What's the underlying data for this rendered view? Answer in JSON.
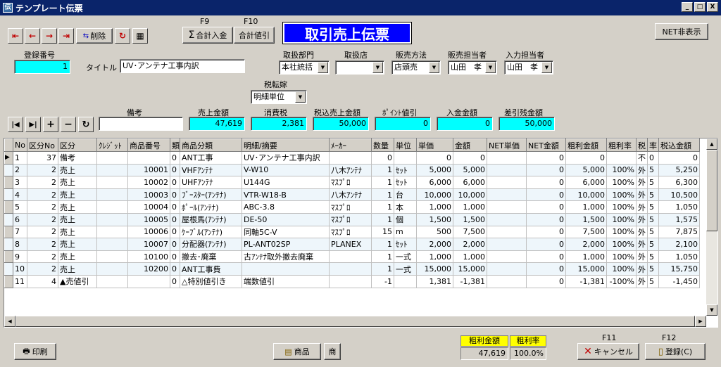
{
  "window": {
    "title": "テンプレート伝票",
    "min": "_",
    "max": "□",
    "close": "X"
  },
  "toolbar": {
    "first": "⇤",
    "prev": "←",
    "next": "→",
    "last": "⇥",
    "delete_label": "削除",
    "refresh": "↻",
    "calc": "▦",
    "f9": "F9",
    "f10": "F10",
    "sum_deposit": "合計入金",
    "sum_discount": "合計値引",
    "sigma": "Σ",
    "net_hide": "NET非表示"
  },
  "doc_title": "取引売上伝票",
  "header": {
    "reg_no_label": "登録番号",
    "reg_no": "1",
    "title_label": "タイトル",
    "title_value": "UV･アンテナ工事内訳",
    "dept_label": "取扱部門",
    "dept": "本社統括",
    "store_label": "取扱店",
    "store": "",
    "method_label": "販売方法",
    "method": "店頭売",
    "sales_person_label": "販売担当者",
    "sales_person": "山田　孝",
    "input_person_label": "入力担当者",
    "input_person": "山田　孝",
    "tax_label": "税転嫁",
    "tax": "明細単位",
    "memo_label": "備考",
    "memo": "",
    "sales_amount_label": "売上金額",
    "sales_amount": "47,619",
    "consumption_tax_label": "消費税",
    "consumption_tax": "2,381",
    "tax_incl_label": "税込売上金額",
    "tax_incl": "50,000",
    "point_label": "ﾎﾟｲﾝﾄ値引",
    "point": "0",
    "deposit_label": "入金金額",
    "deposit": "0",
    "balance_label": "差引残金額",
    "balance": "50,000"
  },
  "nav": {
    "first": "|◀",
    "last": "▶|",
    "add": "+",
    "remove": "−",
    "refresh": "↻"
  },
  "table": {
    "headers": [
      "No",
      "区分No",
      "区分",
      "ｸﾚｼﾞｯﾄ",
      "商品番号",
      "類",
      "商品分類",
      "明細/摘要",
      "ﾒｰｶｰ",
      "数量",
      "単位",
      "単価",
      "金額",
      "NET単価",
      "NET金額",
      "粗利金額",
      "粗利率",
      "税",
      "率",
      "税込金額"
    ],
    "rows": [
      [
        "1",
        "37",
        "備考",
        "",
        "",
        "0",
        "ANT工事",
        "UV･アンテナ工事内訳",
        "",
        "0",
        "",
        "0",
        "0",
        "",
        "0",
        "0",
        "",
        "不",
        "0",
        "0"
      ],
      [
        "2",
        "2",
        "売上",
        "",
        "10001",
        "0",
        "VHFｱﾝﾃﾅ",
        "V-W10",
        "八木ｱﾝﾃﾅ",
        "1",
        "ｾｯﾄ",
        "5,000",
        "5,000",
        "",
        "0",
        "5,000",
        "100%",
        "外",
        "5",
        "5,250"
      ],
      [
        "3",
        "2",
        "売上",
        "",
        "10002",
        "0",
        "UHFｱﾝﾃﾅ",
        "U144G",
        "ﾏｽﾌﾟﾛ",
        "1",
        "ｾｯﾄ",
        "6,000",
        "6,000",
        "",
        "0",
        "6,000",
        "100%",
        "外",
        "5",
        "6,300"
      ],
      [
        "4",
        "2",
        "売上",
        "",
        "10003",
        "0",
        "ﾌﾞｰｽﾀｰ(ｱﾝﾃﾅ)",
        "VTR-W18-B",
        "八木ｱﾝﾃﾅ",
        "1",
        "台",
        "10,000",
        "10,000",
        "",
        "0",
        "10,000",
        "100%",
        "外",
        "5",
        "10,500"
      ],
      [
        "5",
        "2",
        "売上",
        "",
        "10004",
        "0",
        "ﾎﾟｰﾙ(ｱﾝﾃﾅ)",
        "ABC-3.8",
        "ﾏｽﾌﾟﾛ",
        "1",
        "本",
        "1,000",
        "1,000",
        "",
        "0",
        "1,000",
        "100%",
        "外",
        "5",
        "1,050"
      ],
      [
        "6",
        "2",
        "売上",
        "",
        "10005",
        "0",
        "屋根馬(ｱﾝﾃﾅ)",
        "DE-50",
        "ﾏｽﾌﾟﾛ",
        "1",
        "個",
        "1,500",
        "1,500",
        "",
        "0",
        "1,500",
        "100%",
        "外",
        "5",
        "1,575"
      ],
      [
        "7",
        "2",
        "売上",
        "",
        "10006",
        "0",
        "ｹｰﾌﾞﾙ(ｱﾝﾃﾅ)",
        "同軸5C-V",
        "ﾏｽﾌﾟﾛ",
        "15",
        "m",
        "500",
        "7,500",
        "",
        "0",
        "7,500",
        "100%",
        "外",
        "5",
        "7,875"
      ],
      [
        "8",
        "2",
        "売上",
        "",
        "10007",
        "0",
        "分配器(ｱﾝﾃﾅ)",
        "PL-ANT02SP",
        "PLANEX",
        "1",
        "ｾｯﾄ",
        "2,000",
        "2,000",
        "",
        "0",
        "2,000",
        "100%",
        "外",
        "5",
        "2,100"
      ],
      [
        "9",
        "2",
        "売上",
        "",
        "10100",
        "0",
        "撤去･廃棄",
        "古ｱﾝﾃﾅ取外撤去廃棄",
        "",
        "1",
        "一式",
        "1,000",
        "1,000",
        "",
        "0",
        "1,000",
        "100%",
        "外",
        "5",
        "1,050"
      ],
      [
        "10",
        "2",
        "売上",
        "",
        "10200",
        "0",
        "ANT工事費",
        "",
        "",
        "1",
        "一式",
        "15,000",
        "15,000",
        "",
        "0",
        "15,000",
        "100%",
        "外",
        "5",
        "15,750"
      ],
      [
        "11",
        "4",
        "▲売値引",
        "",
        "",
        "0",
        "△特別値引き",
        "端数値引",
        "",
        "-1",
        "",
        "1,381",
        "-1,381",
        "",
        "0",
        "-1,381",
        "-100%",
        "外",
        "5",
        "-1,450"
      ]
    ]
  },
  "footer": {
    "print_label": "印刷",
    "product_label": "商品",
    "product_short": "商",
    "gross_profit_label": "粗利金額",
    "gross_profit": "47,619",
    "gross_rate_label": "粗利率",
    "gross_rate": "100.0%",
    "f11": "F11",
    "cancel_label": "キャンセル",
    "f12": "F12",
    "register_label": "登録(C)"
  },
  "colors": {
    "title_bg": "#0a246a",
    "doc_title_bg": "#0000ff",
    "cyan": "#00ffff",
    "yellow": "#ffff00"
  }
}
